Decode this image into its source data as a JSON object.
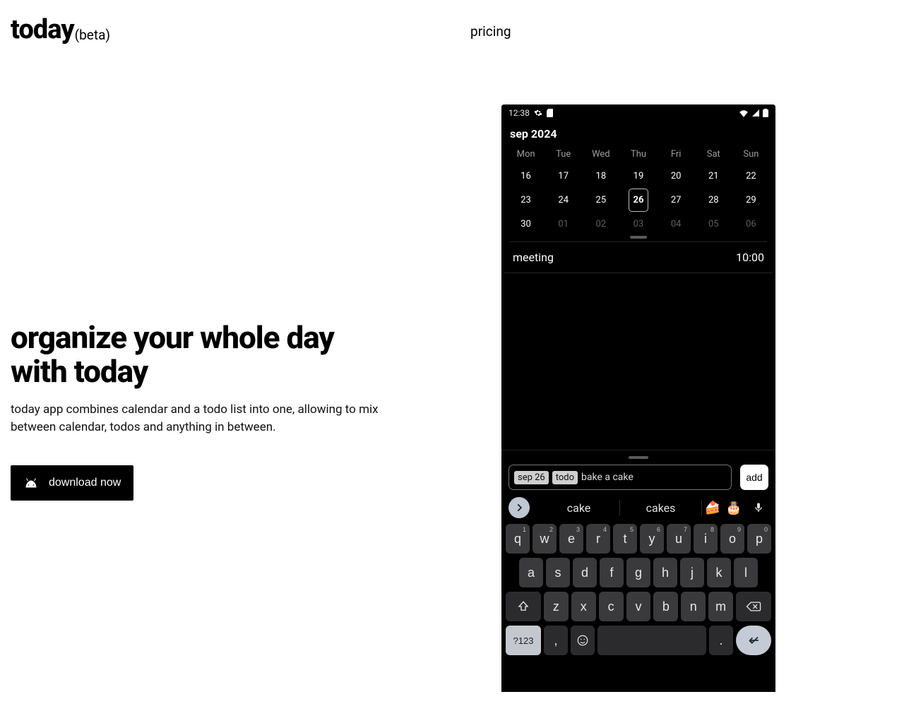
{
  "brand": {
    "title": "today",
    "suffix": "(beta)"
  },
  "nav": {
    "pricing": "pricing"
  },
  "hero": {
    "title_l1": "organize your whole day",
    "title_l2": "with today",
    "subtitle": "today app combines calendar and a todo list into one, allowing to mix between calendar, todos and anything in between.",
    "cta": "download now"
  },
  "phone": {
    "time": "12:38",
    "month": "sep 2024",
    "dow": [
      "Mon",
      "Tue",
      "Wed",
      "Thu",
      "Fri",
      "Sat",
      "Sun"
    ],
    "weeks": [
      [
        {
          "d": "16"
        },
        {
          "d": "17"
        },
        {
          "d": "18"
        },
        {
          "d": "19"
        },
        {
          "d": "20"
        },
        {
          "d": "21"
        },
        {
          "d": "22"
        }
      ],
      [
        {
          "d": "23"
        },
        {
          "d": "24"
        },
        {
          "d": "25"
        },
        {
          "d": "26",
          "today": true
        },
        {
          "d": "27"
        },
        {
          "d": "28"
        },
        {
          "d": "29"
        }
      ],
      [
        {
          "d": "30"
        },
        {
          "d": "01",
          "dim": true
        },
        {
          "d": "02",
          "dim": true
        },
        {
          "d": "03",
          "dim": true
        },
        {
          "d": "04",
          "dim": true
        },
        {
          "d": "05",
          "dim": true
        },
        {
          "d": "06",
          "dim": true
        }
      ]
    ],
    "event": {
      "title": "meeting",
      "time": "10:00"
    },
    "compose": {
      "chip_date": "sep 26",
      "chip_kind": "todo",
      "text": "bake a cake",
      "add": "add"
    },
    "suggestions": {
      "s1": "cake",
      "s2": "cakes",
      "e1": "🍰",
      "e2": "🎂"
    },
    "keyboard": {
      "row1": [
        [
          "q",
          "1"
        ],
        [
          "w",
          "2"
        ],
        [
          "e",
          "3"
        ],
        [
          "r",
          "4"
        ],
        [
          "t",
          "5"
        ],
        [
          "y",
          "6"
        ],
        [
          "u",
          "7"
        ],
        [
          "i",
          "8"
        ],
        [
          "o",
          "9"
        ],
        [
          "p",
          "0"
        ]
      ],
      "row2": [
        "a",
        "s",
        "d",
        "f",
        "g",
        "h",
        "j",
        "k",
        "l"
      ],
      "row3": [
        "z",
        "x",
        "c",
        "v",
        "b",
        "n",
        "m"
      ],
      "alt": "?123",
      "comma": ",",
      "period": "."
    }
  }
}
